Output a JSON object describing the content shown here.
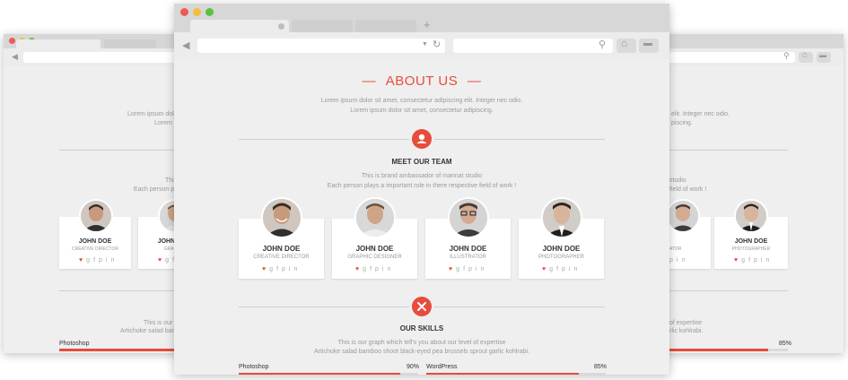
{
  "page": {
    "about": {
      "title": "ABOUT US",
      "dash": "—",
      "line1": "Lorem ipsum dolor sit amet, consectetur adipiscing elit. Integer nec odio.",
      "line2": "Lorem ipsum dolor sit amet, consectetur adipiscing."
    },
    "team": {
      "heading": "MEET OUR TEAM",
      "line1": "This is brand ambassador of mannat studio",
      "line2": "Each person plays a important role in there respective field of work !",
      "members": [
        {
          "name": "JOHN DOE",
          "role": "CREATIVE DIRECTOR"
        },
        {
          "name": "JOHN DOE",
          "role": "GRAPHIC DESIGNER"
        },
        {
          "name": "JOHN DOE",
          "role": "ILLUSTRATOR"
        },
        {
          "name": "JOHN DOE",
          "role": "PHOTOGRAPHER"
        }
      ],
      "social_icons": [
        "heart-icon",
        "google-plus-icon",
        "facebook-icon",
        "pinterest-icon",
        "linkedin-icon"
      ]
    },
    "skills": {
      "heading": "OUR SKILLS",
      "line1": "This is our graph which tell's you about our level of expertise",
      "line2": "Artichoke salad bamboo shoot black-eyed pea brussels sprout garlic kohlrabi.",
      "items": [
        {
          "label": "Photoshop",
          "value": "90%",
          "fraction": 0.9
        },
        {
          "label": "WordPress",
          "value": "85%",
          "fraction": 0.85
        }
      ]
    }
  },
  "left_window": {
    "line1": "Lorem ipsum dolor sit",
    "line2": "Lorem ip",
    "team_line1": "This i",
    "team_line2": "Each person play",
    "members": [
      {
        "name": "JOHN DOE",
        "role": "CREATIVE DIRECTOR"
      },
      {
        "name": "JOHN DOE",
        "role": "GRAPHIC"
      }
    ],
    "skills_line1": "This is our g",
    "skills_line2": "Artichoke salad bamboo",
    "skill_label": "Photoshop"
  },
  "right_window": {
    "line1": "elit. Integer nec odio.",
    "line2": "piscing.",
    "team_line1": "studio",
    "team_line2": "field of work !",
    "members": [
      {
        "name": "",
        "role": "ATOR"
      },
      {
        "name": "JOHN DOE",
        "role": "PHOTOGRAPHER"
      }
    ],
    "skills_line1": "of expertise",
    "skills_line2": "rlic kohlrabi.",
    "skill_value": "85%",
    "skill_fraction": 0.85
  },
  "icons": {
    "new_tab": "+",
    "back": "◀",
    "refresh": "↻",
    "search": "⚲",
    "home": "⌂",
    "menu": "▬"
  },
  "colors": {
    "accent": "#e74c3c",
    "close_dot": "#ee5b55",
    "minimize_dot": "#f5bd3c",
    "zoom_dot": "#5bc13f"
  }
}
